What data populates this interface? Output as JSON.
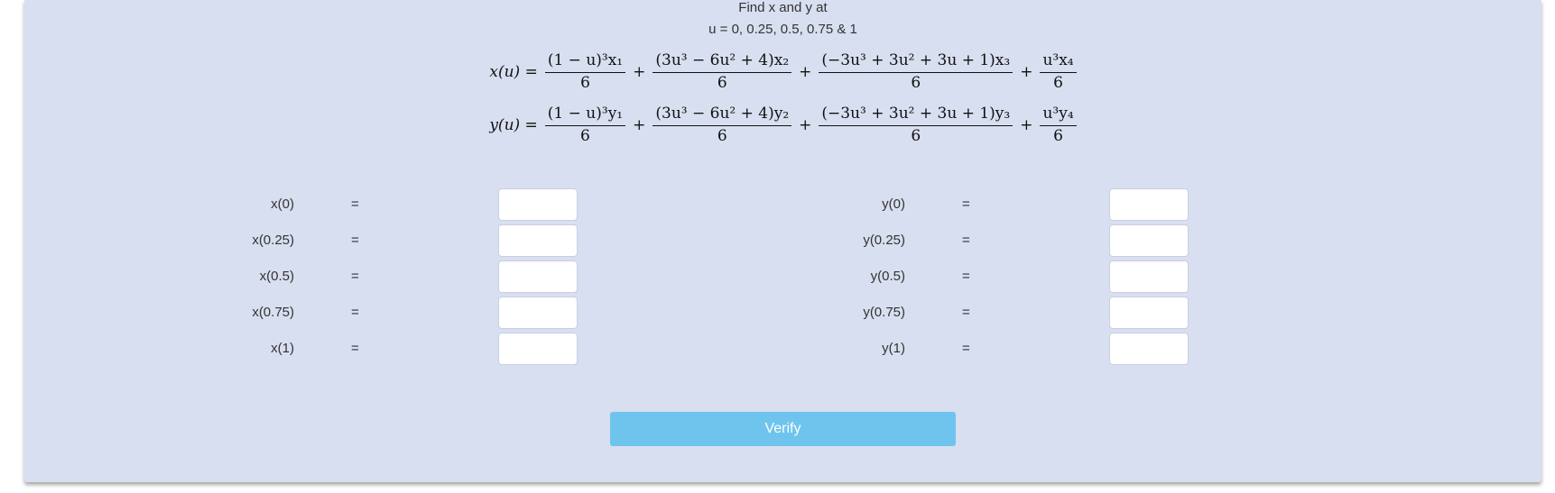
{
  "header": {
    "line1": "Find x and y at",
    "line2": "u = 0, 0.25, 0.5, 0.75 & 1"
  },
  "equations": {
    "x": {
      "lhs": "x(u) =",
      "t1_num": "(1 − u)³x₁",
      "t2_num": "(3u³ − 6u² + 4)x₂",
      "t3_num": "(−3u³ + 3u² + 3u + 1)x₃",
      "t4_num": "u³x₄",
      "den": "6",
      "plus": "+"
    },
    "y": {
      "lhs": "y(u) =",
      "t1_num": "(1 − u)³y₁",
      "t2_num": "(3u³ − 6u² + 4)y₂",
      "t3_num": "(−3u³ + 3u² + 3u + 1)y₃",
      "t4_num": "u³y₄",
      "den": "6",
      "plus": "+"
    }
  },
  "rows": [
    {
      "x_label": "x(0)",
      "y_label": "y(0)",
      "eq": "=",
      "x_value": "",
      "y_value": ""
    },
    {
      "x_label": "x(0.25)",
      "y_label": "y(0.25)",
      "eq": "=",
      "x_value": "",
      "y_value": ""
    },
    {
      "x_label": "x(0.5)",
      "y_label": "y(0.5)",
      "eq": "=",
      "x_value": "",
      "y_value": ""
    },
    {
      "x_label": "x(0.75)",
      "y_label": "y(0.75)",
      "eq": "=",
      "x_value": "",
      "y_value": ""
    },
    {
      "x_label": "x(1)",
      "y_label": "y(1)",
      "eq": "=",
      "x_value": "",
      "y_value": ""
    }
  ],
  "verify_label": "Verify",
  "colors": {
    "panel_bg": "#d8dff0",
    "button_bg": "#6fc4ee",
    "button_text": "#ffffff"
  }
}
